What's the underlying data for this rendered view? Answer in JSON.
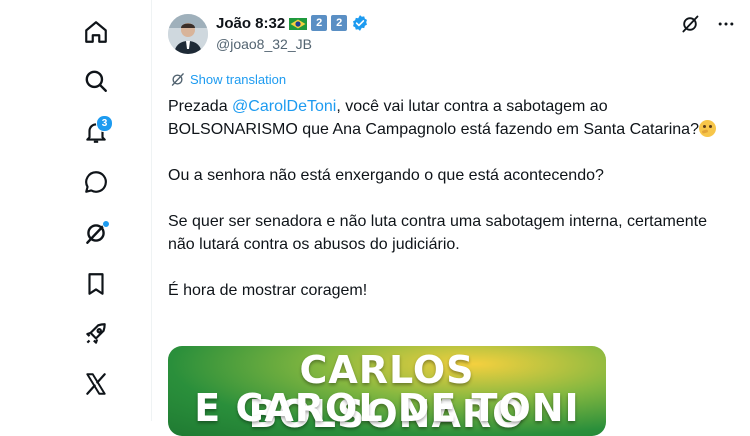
{
  "nav": {
    "items": [
      {
        "icon": "home-icon"
      },
      {
        "icon": "search-icon"
      },
      {
        "icon": "bell-icon",
        "badge": "3"
      },
      {
        "icon": "chat-bubble-icon"
      },
      {
        "icon": "grok-icon"
      },
      {
        "icon": "bookmark-icon"
      },
      {
        "icon": "rocket-icon"
      },
      {
        "icon": "x-logo-icon"
      }
    ]
  },
  "tweet": {
    "display_name": "João 8:32",
    "badges": [
      "2",
      "2"
    ],
    "handle": "@joao8_32_JB",
    "show_translation": "Show translation",
    "greeting_prefix": "Prezada ",
    "mention": "@CarolDeToni",
    "line1_rest": ", você vai lutar contra a sabotagem ao BOLSONARISMO que Ana Campagnolo está fazendo em Santa Catarina?",
    "p2": "Ou a senhora não está enxergando o que está acontecendo?",
    "p3": "Se quer ser senadora e não luta contra uma sabotagem interna, certamente não lutará contra os abusos do judiciário.",
    "p4": "É hora de mostrar coragem!",
    "media_line1": "CARLOS BOLSONARO",
    "media_line2": "E CAROL DE TONI"
  },
  "colors": {
    "accent": "#1d9bf0",
    "text": "#0f1419",
    "muted": "#536471"
  }
}
